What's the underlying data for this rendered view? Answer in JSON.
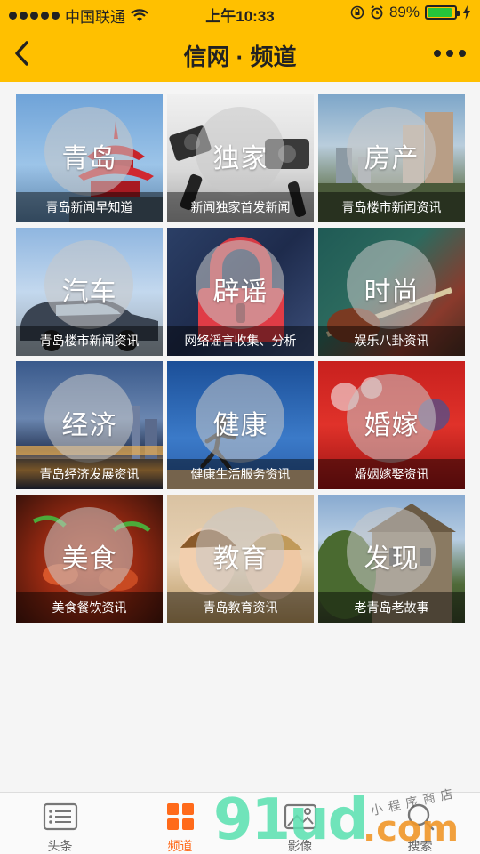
{
  "status": {
    "carrier": "中国联通",
    "time": "上午10:33",
    "battery": "89%",
    "battery_level": 0.89
  },
  "nav": {
    "title": "信网 · 频道"
  },
  "tiles": [
    {
      "title": "青岛",
      "caption": "青岛新闻早知道"
    },
    {
      "title": "独家",
      "caption": "新闻独家首发新闻"
    },
    {
      "title": "房产",
      "caption": "青岛楼市新闻资讯"
    },
    {
      "title": "汽车",
      "caption": "青岛楼市新闻资讯"
    },
    {
      "title": "辟谣",
      "caption": "网络谣言收集、分析"
    },
    {
      "title": "时尚",
      "caption": "娱乐八卦资讯"
    },
    {
      "title": "经济",
      "caption": "青岛经济发展资讯"
    },
    {
      "title": "健康",
      "caption": "健康生活服务资讯"
    },
    {
      "title": "婚嫁",
      "caption": "婚姻嫁娶资讯"
    },
    {
      "title": "美食",
      "caption": "美食餐饮资讯"
    },
    {
      "title": "教育",
      "caption": "青岛教育资讯"
    },
    {
      "title": "发现",
      "caption": "老青岛老故事"
    }
  ],
  "tabs": [
    {
      "label": "头条",
      "icon": "list-icon"
    },
    {
      "label": "频道",
      "icon": "grid-icon",
      "active": true
    },
    {
      "label": "影像",
      "icon": "image-icon"
    },
    {
      "label": "搜索",
      "icon": "search-icon"
    }
  ],
  "watermark": {
    "text": "91ud",
    "domain": ".com",
    "sub": "小程序商店"
  },
  "colors": {
    "accent": "#ffc000",
    "active_tab": "#ff6a1a"
  }
}
